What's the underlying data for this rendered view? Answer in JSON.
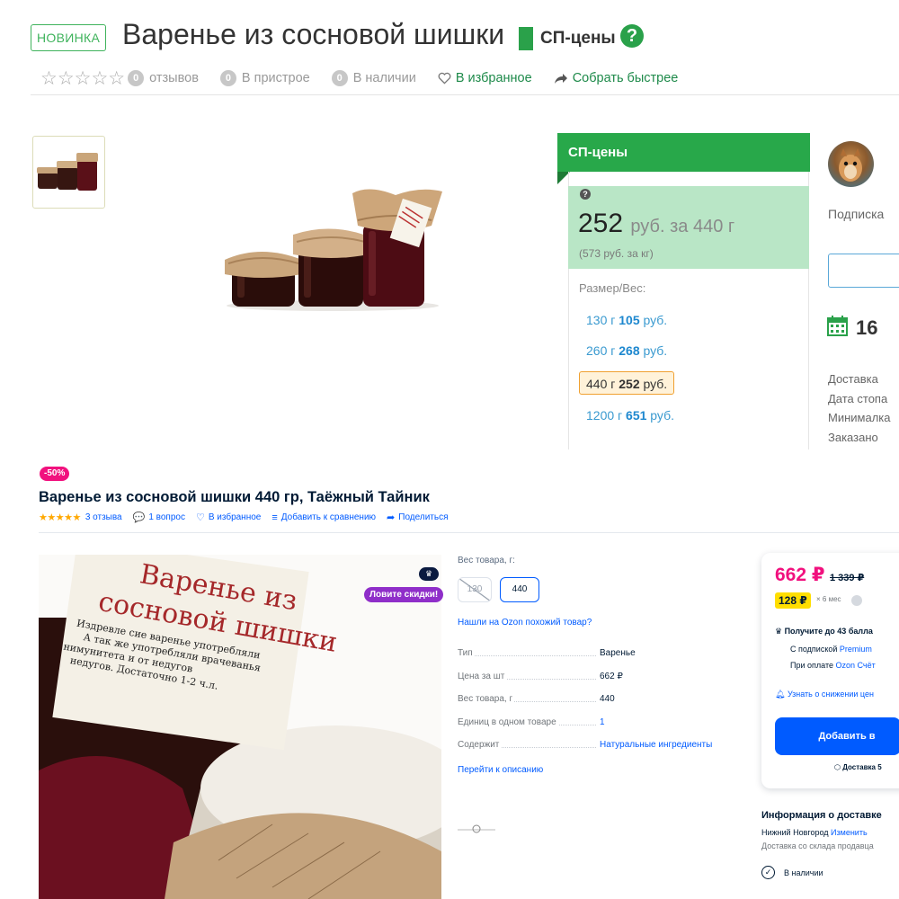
{
  "sp": {
    "badge": "НОВИНКА",
    "title": "Варенье из сосновой шишки",
    "brand": "СП-цены",
    "help_icon": "?",
    "meta": {
      "stars": "☆☆☆☆☆",
      "reviews_count": "0",
      "reviews_label": "отзывов",
      "setup_count": "0",
      "setup_label": "В пристрое",
      "stock_count": "0",
      "stock_label": "В наличии",
      "favorite_label": "В избранное",
      "collect_label": "Собрать быстрее"
    },
    "panel": {
      "header": "СП-цены",
      "price": "252",
      "price_unit": "руб. за 440 г",
      "price_per_kg": "(573 руб. за кг)",
      "size_label": "Размер/Вес:",
      "sizes": [
        {
          "weight": "130 г",
          "price": "105",
          "currency": "руб."
        },
        {
          "weight": "260 г",
          "price": "268",
          "currency": "руб."
        },
        {
          "weight": "440 г",
          "price": "252",
          "currency": "руб.",
          "selected": true
        },
        {
          "weight": "1200 г",
          "price": "651",
          "currency": "руб."
        }
      ]
    },
    "side": {
      "subscription_label": "Подписка",
      "date_number": "16",
      "lines": [
        "Доставка",
        "Дата стопа",
        "Минималка",
        "Заказано"
      ]
    }
  },
  "ozon": {
    "discount": "-50%",
    "title": "Варенье из сосновой шишки 440 гр, Таёжный Тайник",
    "meta": {
      "stars": "★★★★★",
      "reviews": "3 отзыва",
      "questions": "1 вопрос",
      "favorite": "В избранное",
      "compare": "Добавить к сравнению",
      "share": "Поделиться"
    },
    "promo": "Ловите скидки!",
    "weight_label": "Вес товара, г:",
    "weight_options": [
      "130",
      "440"
    ],
    "similar_link": "Нашли на Ozon похожий товар?",
    "properties": [
      {
        "key": "Тип",
        "value": "Варенье",
        "link": false
      },
      {
        "key": "Цена за шт",
        "value": "662 ₽",
        "link": false
      },
      {
        "key": "Вес товара, г",
        "value": "440",
        "link": false
      },
      {
        "key": "Единиц в одном товаре",
        "value": "1",
        "link": false
      },
      {
        "key": "Содержит",
        "value": "Натуральные ингредиенты",
        "link": true
      }
    ],
    "desc_link": "Перейти к описанию",
    "price": "662 ₽",
    "old_price": "1 339 ₽",
    "installment": "128 ₽",
    "installment_term": "× 6 мес",
    "bonus": "Получите до 43 балла",
    "sub_premium_prefix": "С подпиской",
    "sub_premium_link": "Premium",
    "sub_card_prefix": "При оплате",
    "sub_card_link": "Ozon Счёт",
    "notify": "Узнать о снижении цен",
    "add_button": "Добавить в",
    "delivery_small": "Доставка 5",
    "info_title": "Информация о доставке",
    "city": "Нижний Новгород",
    "city_change": "Изменить",
    "from_seller": "Доставка со склада продавца",
    "in_stock": "В наличии",
    "colors": {
      "accent": "#005bff",
      "price": "#f1117e",
      "discount": "#f1117e",
      "promo": "#8f2ec9",
      "installment": "#ffde00"
    }
  },
  "colors": {
    "sp_green": "#28a84a",
    "sp_price_bg": "#b9e6c6",
    "sp_link": "#1e88cf"
  }
}
